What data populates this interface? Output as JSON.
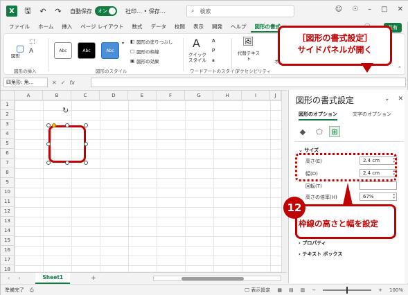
{
  "titlebar": {
    "app_logo": "X",
    "autosave_label": "自動保存",
    "autosave_toggle": "オン",
    "doc_title": "社印… • 保存…",
    "search_placeholder": "検索"
  },
  "menu": {
    "tabs": [
      "ファイル",
      "ホーム",
      "挿入",
      "ページ レイアウト",
      "数式",
      "データ",
      "校閲",
      "表示",
      "開発",
      "ヘルプ",
      "図形の書式"
    ],
    "active_tab": "図形の書式",
    "share_label": "共有"
  },
  "ribbon": {
    "insert_shapes_label": "図形の挿入",
    "shape_label": "図形",
    "styles": [
      "Abc",
      "Abc",
      "Abc"
    ],
    "shape_styles_label": "図形のスタイル",
    "fill_label": "図形の塗りつぶし",
    "outline_label": "図形の枠線",
    "effects_label": "図形の効果",
    "quick_styles_label": "クイック スタイル",
    "wordart_label": "ワードアートのスタイル",
    "alt_text_label": "代替テキスト",
    "accessibility_label": "アクセシビリティ",
    "arrange_label": "オブ"
  },
  "formula_bar": {
    "name_box": "四角形: 角…",
    "fx": "fx"
  },
  "sheet": {
    "columns": [
      "A",
      "B",
      "C",
      "D",
      "E",
      "F",
      "G",
      "H",
      "I",
      "J"
    ],
    "rows": [
      "1",
      "2",
      "3",
      "4",
      "5",
      "6",
      "7",
      "8",
      "9",
      "10",
      "11",
      "12",
      "13",
      "14",
      "15",
      "16",
      "17",
      "18"
    ],
    "tabs": [
      "Sheet1"
    ],
    "add_sheet": "+"
  },
  "status": {
    "ready": "準備完了",
    "display_settings": "表示設定",
    "zoom": "100%"
  },
  "panel": {
    "title": "図形の書式設定",
    "tabs": [
      "図形のオプション",
      "文字のオプション"
    ],
    "active_tab": "図形のオプション",
    "size_section": "サイズ",
    "height_label": "高さ(E)",
    "height_value": "2.4 cm",
    "width_label": "幅(D)",
    "width_value": "2.4 cm",
    "rotate_label": "回転(T)",
    "height_scale_label": "高さの倍率(H)",
    "height_scale_value": "67%",
    "properties_section": "プロパティ",
    "textbox_section": "テキスト ボックス"
  },
  "annotations": {
    "top_line1": "［図形の書式設定］",
    "top_line2": "サイドパネルが開く",
    "step_number": "12",
    "bottom_text": "枠線の高さと幅を設定"
  },
  "colors": {
    "excel_green": "#107c41",
    "annotation_red": "#c00000"
  }
}
